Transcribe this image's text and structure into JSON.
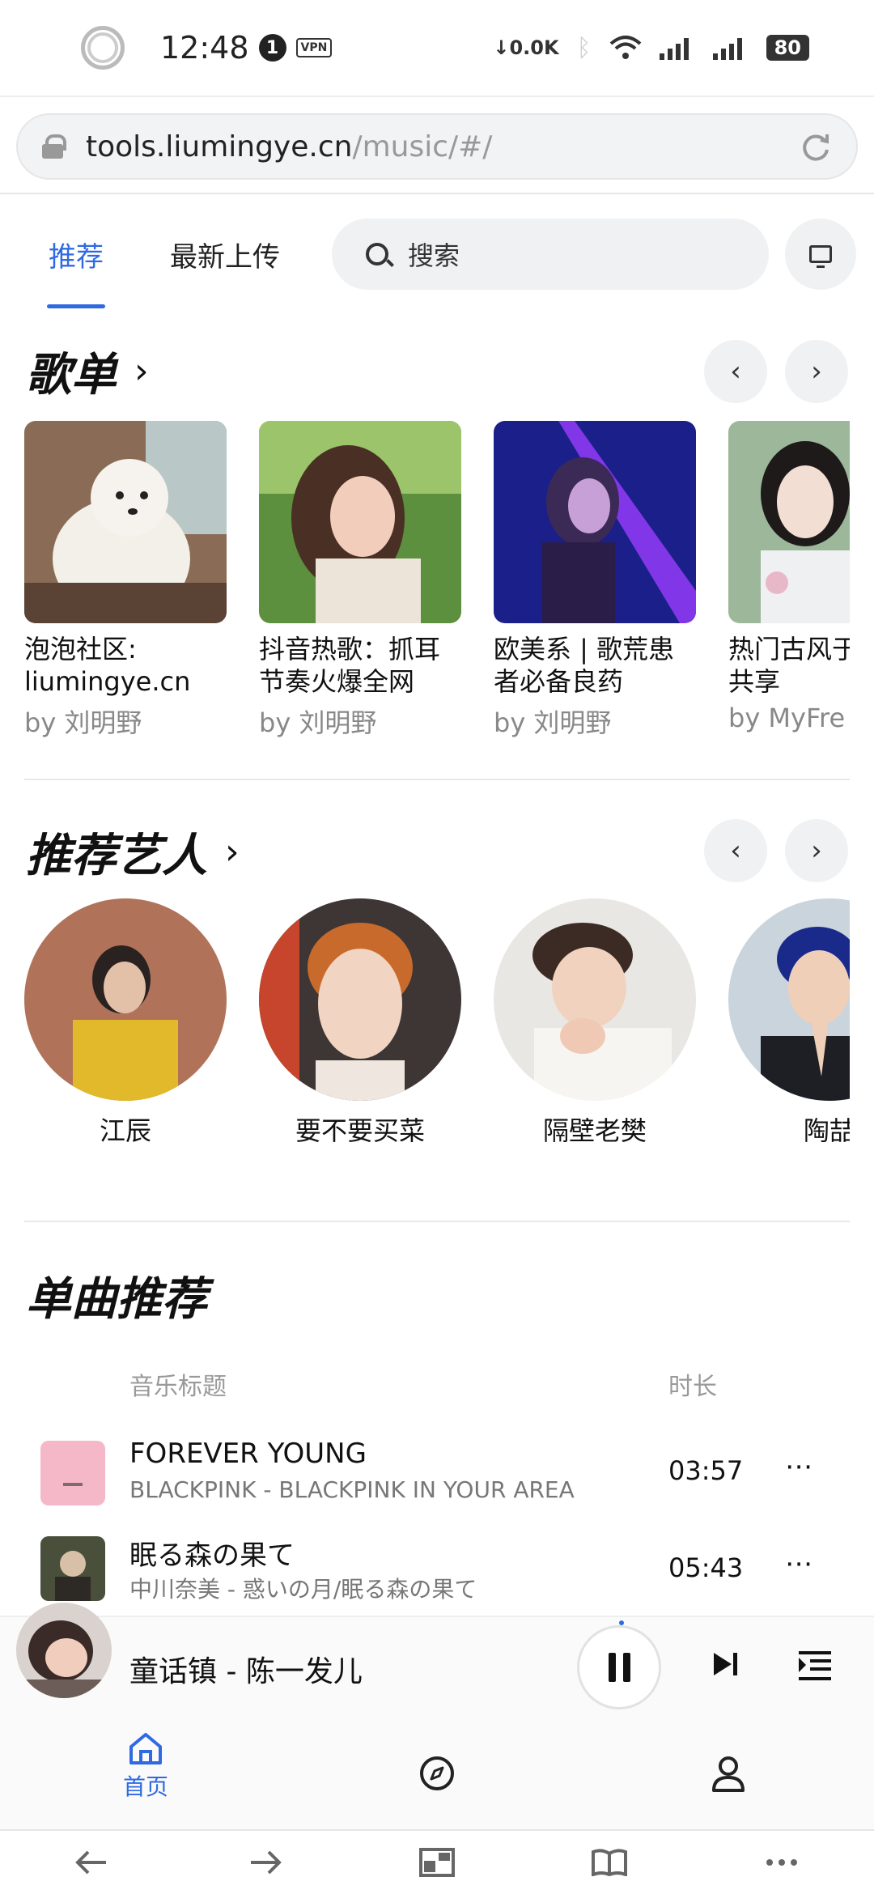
{
  "status_bar": {
    "time": "12:48",
    "notification_count": "1",
    "vpn": "VPN",
    "net_speed": "0.0K",
    "battery": "80"
  },
  "address_bar": {
    "host": "tools.liumingye.cn",
    "path": "/music/#/"
  },
  "nav": {
    "tabs": [
      {
        "label": "推荐",
        "active": true
      },
      {
        "label": "最新上传",
        "active": false
      }
    ],
    "search_placeholder": "搜索"
  },
  "playlists": {
    "title": "歌单",
    "items": [
      {
        "title": "泡泡社区: liumingye.cn",
        "by": "by 刘明野"
      },
      {
        "title": "抖音热歌：抓耳节奏火爆全网",
        "by": "by 刘明野"
      },
      {
        "title": "欧美系 | 歌荒患者必备良药",
        "by": "by 刘明野"
      },
      {
        "title": "热门古风于心，共享",
        "by": "by MyFre"
      }
    ]
  },
  "artists": {
    "title": "推荐艺人",
    "items": [
      {
        "name": "江辰"
      },
      {
        "name": "要不要买菜"
      },
      {
        "name": "隔壁老樊"
      },
      {
        "name": "陶喆"
      }
    ]
  },
  "songs": {
    "title": "单曲推荐",
    "col_title": "音乐标题",
    "col_duration": "时长",
    "items": [
      {
        "title": "FOREVER YOUNG",
        "subtitle": "BLACKPINK - BLACKPINK IN YOUR AREA",
        "duration": "03:57"
      },
      {
        "title": "眠る森の果て",
        "subtitle": "中川奈美 - 惑いの月/眠る森の果て",
        "duration": "05:43"
      }
    ]
  },
  "player": {
    "now_playing": "童话镇 - 陈一发儿"
  },
  "app_nav": {
    "home_label": "首页"
  },
  "colors": {
    "accent": "#2f6ae3"
  }
}
